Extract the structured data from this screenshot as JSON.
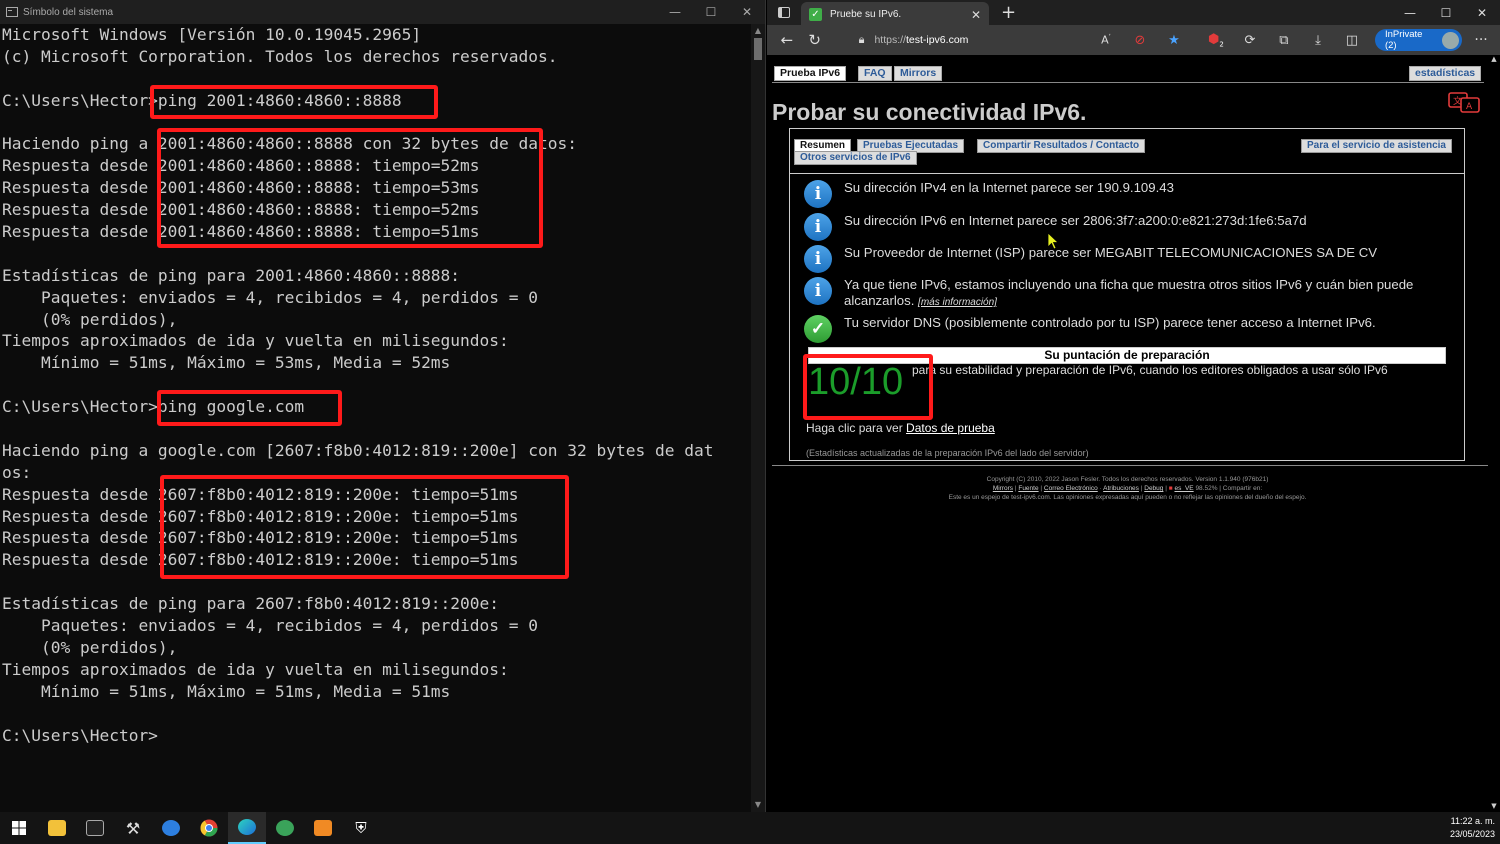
{
  "cmd": {
    "title": "Símbolo del sistema",
    "lines": [
      "Microsoft Windows [Versión 10.0.19045.2965]",
      "(c) Microsoft Corporation. Todos los derechos reservados.",
      "",
      "C:\\Users\\Hector>ping 2001:4860:4860::8888",
      "",
      "Haciendo ping a 2001:4860:4860::8888 con 32 bytes de datos:",
      "Respuesta desde 2001:4860:4860::8888: tiempo=52ms",
      "Respuesta desde 2001:4860:4860::8888: tiempo=53ms",
      "Respuesta desde 2001:4860:4860::8888: tiempo=52ms",
      "Respuesta desde 2001:4860:4860::8888: tiempo=51ms",
      "",
      "Estadísticas de ping para 2001:4860:4860::8888:",
      "    Paquetes: enviados = 4, recibidos = 4, perdidos = 0",
      "    (0% perdidos),",
      "Tiempos aproximados de ida y vuelta en milisegundos:",
      "    Mínimo = 51ms, Máximo = 53ms, Media = 52ms",
      "",
      "C:\\Users\\Hector>ping google.com",
      "",
      "Haciendo ping a google.com [2607:f8b0:4012:819::200e] con 32 bytes de dat",
      "os:",
      "Respuesta desde 2607:f8b0:4012:819::200e: tiempo=51ms",
      "Respuesta desde 2607:f8b0:4012:819::200e: tiempo=51ms",
      "Respuesta desde 2607:f8b0:4012:819::200e: tiempo=51ms",
      "Respuesta desde 2607:f8b0:4012:819::200e: tiempo=51ms",
      "",
      "Estadísticas de ping para 2607:f8b0:4012:819::200e:",
      "    Paquetes: enviados = 4, recibidos = 4, perdidos = 0",
      "    (0% perdidos),",
      "Tiempos aproximados de ida y vuelta en milisegundos:",
      "    Mínimo = 51ms, Máximo = 51ms, Media = 51ms",
      "",
      "C:\\Users\\Hector>"
    ]
  },
  "browser": {
    "tab_title": "Pruebe su IPv6.",
    "url_protocol": "https://",
    "url_host": "test-ipv6.com",
    "inprivate_label": "InPrivate (2)",
    "badge_count": "2"
  },
  "page": {
    "nav": {
      "tab_prueba": "Prueba IPv6",
      "tab_faq": "FAQ",
      "tab_mirrors": "Mirrors",
      "tab_stats": "estadísticas"
    },
    "title": "Probar su conectividad IPv6.",
    "subtabs": {
      "resumen": "Resumen",
      "pruebas": "Pruebas Ejecutadas",
      "compartir": "Compartir Resultados / Contacto",
      "asistencia": "Para el servicio de asistencia",
      "otros": "Otros servicios de IPv6"
    },
    "info": {
      "ipv4": "Su dirección IPv4 en la Internet parece ser 190.9.109.43",
      "ipv6": "Su dirección IPv6 en Internet parece ser 2806:3f7:a200:0:e821:273d:1fe6:5a7d",
      "isp": "Su Proveedor de Internet (ISP) parece ser MEGABIT TELECOMUNICACIONES SA DE CV",
      "has_ipv6": "Ya que tiene IPv6, estamos incluyendo una ficha que muestra otros sitios IPv6 y cuán bien puede alcanzarlos.",
      "more_info": "[más información]",
      "dns": "Tu servidor DNS (posiblemente controlado por tu ISP) parece tener acceso a Internet IPv6."
    },
    "score": {
      "title": "Su puntación de preparación",
      "value": "10/10",
      "desc": "para su estabilidad y preparación de IPv6, cuando los editores obligados a usar sólo IPv6"
    },
    "test_data_prefix": "Haga clic para ver ",
    "test_data_link": "Datos de prueba",
    "stats_note": "(Estadísticas actualizadas de la preparación IPv6 del lado del servidor)",
    "footer": {
      "line1": "Copyright (C) 2010, 2022 Jason Fesler. Todos los derechos reservados. Version 1.1.940 (976b21)",
      "mirrors": "Mirrors",
      "fuente": "Fuente",
      "correo": "Correo Electrónico",
      "atribuciones": "Atribuciones",
      "debug": "Debug",
      "region": "es_VE",
      "pct": "98.52%",
      "share": "Compartir en:",
      "line3": "Este es un espejo de test-ipv6.com. Las opiniones expresadas aquí pueden o no reflejar las opiniones del dueño del espejo."
    }
  },
  "taskbar": {
    "time": "11:22 a. m.",
    "date": "23/05/2023"
  },
  "colors": {
    "highlight_box": "#ff1a1a",
    "score_green": "#1b9d2a",
    "info_blue": "#1e73c2",
    "inprivate_blue": "#1969c8"
  }
}
